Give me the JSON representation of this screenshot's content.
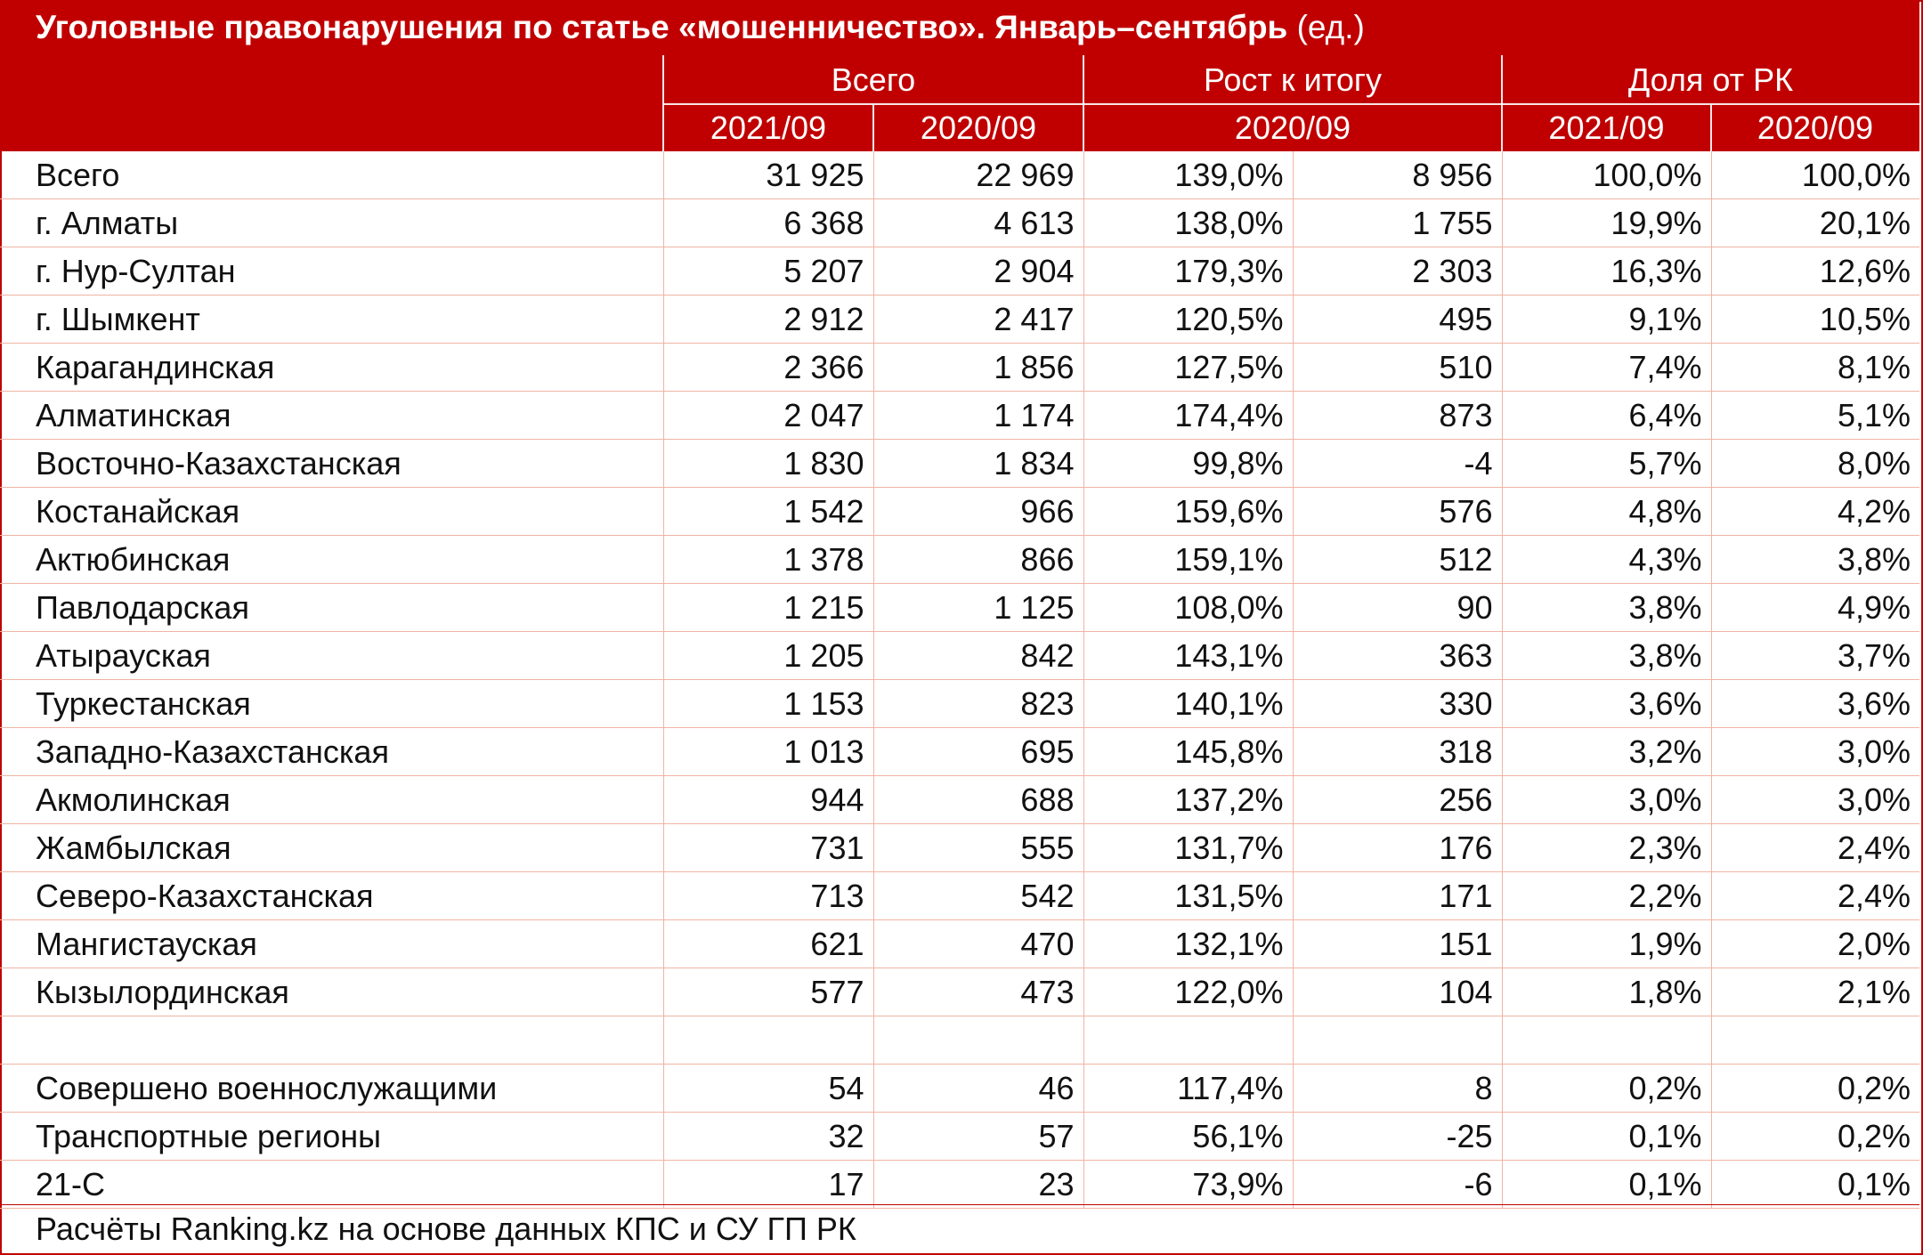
{
  "title": "Уголовные правонарушения по статье «мошенничество». Январь–сентябрь",
  "title_unit": "(ед.)",
  "headers": {
    "group_total": "Всего",
    "group_growth": "Рост к итогу",
    "group_share": "Доля от РК",
    "total_2021": "2021/09",
    "total_2020": "2020/09",
    "growth_period": "2020/09",
    "share_2021": "2021/09",
    "share_2020": "2020/09"
  },
  "footer": "Расчёты Ranking.kz на основе данных КПС и СУ ГП РК",
  "colors": {
    "header_bg": "#c00000",
    "header_text": "#ffffff",
    "grid": "#f0b4a4"
  },
  "chart_data": {
    "type": "table",
    "rows": [
      [
        "Всего",
        "31 925",
        "22 969",
        "139,0%",
        "8 956",
        "100,0%",
        "100,0%"
      ],
      [
        "г. Алматы",
        "6 368",
        "4 613",
        "138,0%",
        "1 755",
        "19,9%",
        "20,1%"
      ],
      [
        "г. Нур-Султан",
        "5 207",
        "2 904",
        "179,3%",
        "2 303",
        "16,3%",
        "12,6%"
      ],
      [
        "г. Шымкент",
        "2 912",
        "2 417",
        "120,5%",
        "495",
        "9,1%",
        "10,5%"
      ],
      [
        "Карагандинская",
        "2 366",
        "1 856",
        "127,5%",
        "510",
        "7,4%",
        "8,1%"
      ],
      [
        "Алматинская",
        "2 047",
        "1 174",
        "174,4%",
        "873",
        "6,4%",
        "5,1%"
      ],
      [
        "Восточно-Казахстанская",
        "1 830",
        "1 834",
        "99,8%",
        "-4",
        "5,7%",
        "8,0%"
      ],
      [
        "Костанайская",
        "1 542",
        "966",
        "159,6%",
        "576",
        "4,8%",
        "4,2%"
      ],
      [
        "Актюбинская",
        "1 378",
        "866",
        "159,1%",
        "512",
        "4,3%",
        "3,8%"
      ],
      [
        "Павлодарская",
        "1 215",
        "1 125",
        "108,0%",
        "90",
        "3,8%",
        "4,9%"
      ],
      [
        "Атырауская",
        "1 205",
        "842",
        "143,1%",
        "363",
        "3,8%",
        "3,7%"
      ],
      [
        "Туркестанская",
        "1 153",
        "823",
        "140,1%",
        "330",
        "3,6%",
        "3,6%"
      ],
      [
        "Западно-Казахстанская",
        "1 013",
        "695",
        "145,8%",
        "318",
        "3,2%",
        "3,0%"
      ],
      [
        "Акмолинская",
        "944",
        "688",
        "137,2%",
        "256",
        "3,0%",
        "3,0%"
      ],
      [
        "Жамбылская",
        "731",
        "555",
        "131,7%",
        "176",
        "2,3%",
        "2,4%"
      ],
      [
        "Северо-Казахстанская",
        "713",
        "542",
        "131,5%",
        "171",
        "2,2%",
        "2,4%"
      ],
      [
        "Мангистауская",
        "621",
        "470",
        "132,1%",
        "151",
        "1,9%",
        "2,0%"
      ],
      [
        "Кызылординская",
        "577",
        "473",
        "122,0%",
        "104",
        "1,8%",
        "2,1%"
      ],
      [
        "",
        "",
        "",
        "",
        "",
        "",
        ""
      ],
      [
        "Совершено военнослужащими",
        "54",
        "46",
        "117,4%",
        "8",
        "0,2%",
        "0,2%"
      ],
      [
        "Транспортные регионы",
        "32",
        "57",
        "56,1%",
        "-25",
        "0,1%",
        "0,2%"
      ],
      [
        "21-С",
        "17",
        "23",
        "73,9%",
        "-6",
        "0,1%",
        "0,1%"
      ]
    ]
  }
}
